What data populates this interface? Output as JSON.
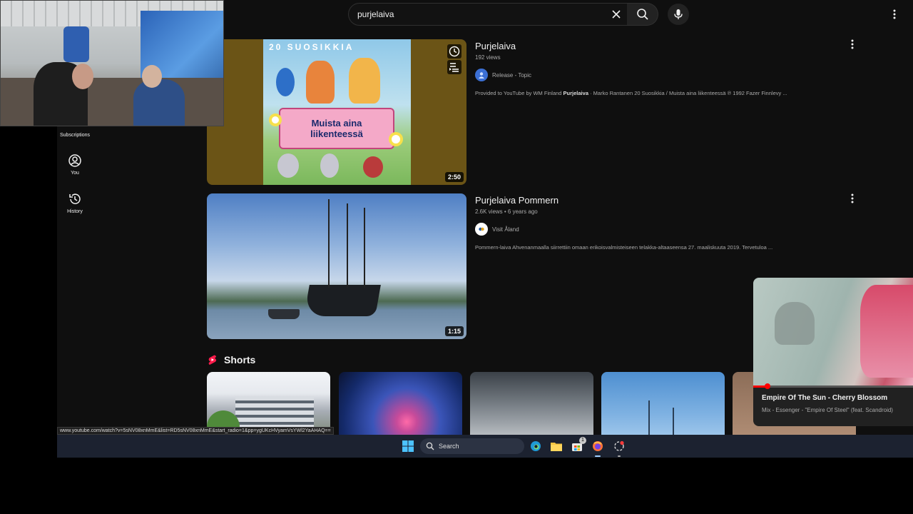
{
  "search": {
    "query": "purjelaiva"
  },
  "sidebar": {
    "items": [
      {
        "label": "Subscriptions",
        "icon": "subscriptions-icon"
      },
      {
        "label": "You",
        "icon": "account-circle-icon"
      },
      {
        "label": "History",
        "icon": "history-icon"
      }
    ]
  },
  "results": [
    {
      "title": "Purjelaiva",
      "meta": "192 views",
      "channel": "Release - Topic",
      "description_prefix": "Provided to YouTube by WM Finland ",
      "description_bold": "Purjelaiva",
      "description_suffix": " · Marko Rantanen 20 Suosikkia / Muista aina liikenteessä ℗ 1992 Fazer Finnlevy ...",
      "duration": "2:50",
      "cover_line1": "20 SUOSIKKIA",
      "cover_line2": "Muista aina",
      "cover_line3": "liikenteessä",
      "hover_actions": [
        "watch-later-icon",
        "add-to-queue-icon"
      ]
    },
    {
      "title": "Purjelaiva Pommern",
      "meta": "2.6K views • 6 years ago",
      "channel": "Visit Åland",
      "description": "Pommern-laiva Ahvenanmaalla siirrettiin omaan erikoisvalmisteiseen telakka-altaaseensa 27. maaliskuuta 2019. Tervetuloa ...",
      "duration": "1:15"
    }
  ],
  "shorts": {
    "heading": "Shorts",
    "count": 5
  },
  "miniplayer": {
    "title": "Empire Of The Sun - Cherry Blossom",
    "subtitle": "Mix - Essenger - \"Empire Of Steel\" (feat. Scandroid)",
    "progress": 0.09
  },
  "status_url": "www.youtube.com/watch?v=5sNV08xnMmE&list=RD5sNV08xnMmE&start_radio=1&pp=ygUKcHVyamVsYWl2YaAHAQ==",
  "taskbar": {
    "search_label": "Search",
    "store_badge": "1"
  },
  "colors": {
    "background": "#0f0f0f",
    "accent_red": "#ff0000",
    "taskbar": "#1c2230"
  }
}
